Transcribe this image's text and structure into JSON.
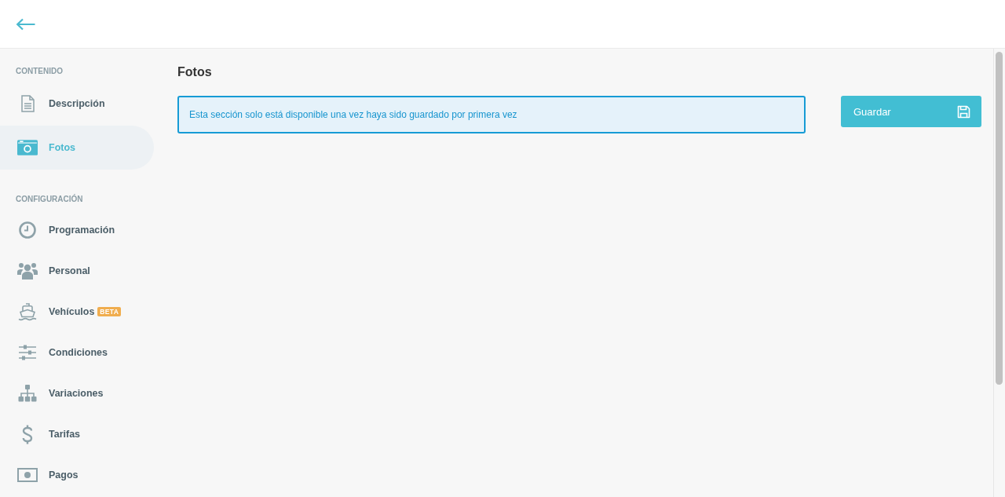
{
  "sidebar": {
    "sections": [
      {
        "title": "CONTENIDO",
        "items": [
          {
            "label": "Descripción",
            "selected": false
          },
          {
            "label": "Fotos",
            "selected": true
          }
        ]
      },
      {
        "title": "CONFIGURACIÓN",
        "items": [
          {
            "label": "Programación",
            "selected": false
          },
          {
            "label": "Personal",
            "selected": false
          },
          {
            "label": "Vehículos",
            "badge": "BETA",
            "selected": false
          },
          {
            "label": "Condiciones",
            "selected": false
          },
          {
            "label": "Variaciones",
            "selected": false
          },
          {
            "label": "Tarifas",
            "selected": false
          },
          {
            "label": "Pagos",
            "selected": false
          }
        ]
      }
    ]
  },
  "main": {
    "title": "Fotos",
    "notice": "Esta sección solo está disponible una vez haya sido guardado por primera vez",
    "save_button": {
      "label": "Guardar"
    }
  }
}
